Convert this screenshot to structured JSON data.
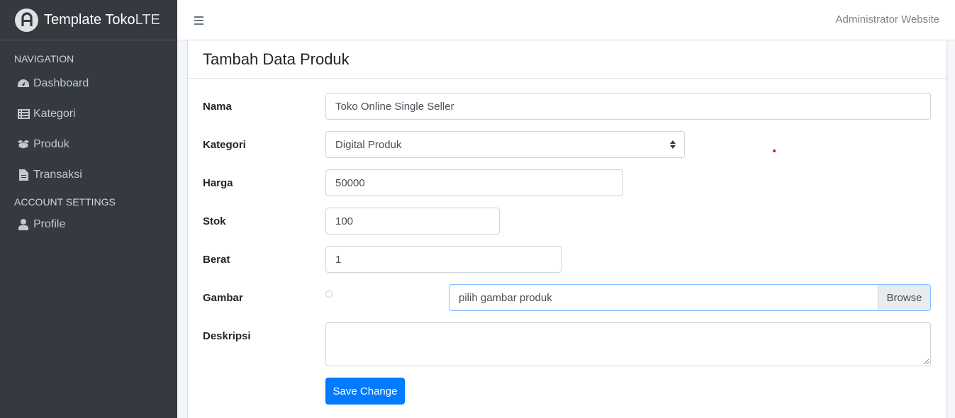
{
  "brand": {
    "name_bold": "Template Toko",
    "name_light": "LTE"
  },
  "sidebar": {
    "headers": {
      "navigation": "NAVIGATION",
      "account": "ACCOUNT SETTINGS"
    },
    "items": [
      {
        "label": "Dashboard",
        "icon": "tachometer-icon"
      },
      {
        "label": "Kategori",
        "icon": "list-icon"
      },
      {
        "label": "Produk",
        "icon": "box-open-icon"
      },
      {
        "label": "Transaksi",
        "icon": "file-icon"
      },
      {
        "label": "Profile",
        "icon": "user-icon"
      }
    ]
  },
  "topbar": {
    "admin": "Administrator Website"
  },
  "card": {
    "title": "Tambah Data Produk"
  },
  "form": {
    "nama": {
      "label": "Nama",
      "value": "Toko Online Single Seller"
    },
    "kategori": {
      "label": "Kategori",
      "value": "Digital Produk"
    },
    "harga": {
      "label": "Harga",
      "value": "50000"
    },
    "stok": {
      "label": "Stok",
      "value": "100"
    },
    "berat": {
      "label": "Berat",
      "value": "1"
    },
    "gambar": {
      "label": "Gambar",
      "placeholder": "pilih gambar produk",
      "browse": "Browse"
    },
    "deskripsi": {
      "label": "Deskripsi",
      "value": ""
    },
    "submit": "Save Change"
  },
  "colors": {
    "sidebar": "#343a40",
    "primary": "#007bff",
    "focus_border": "#80bdff"
  }
}
